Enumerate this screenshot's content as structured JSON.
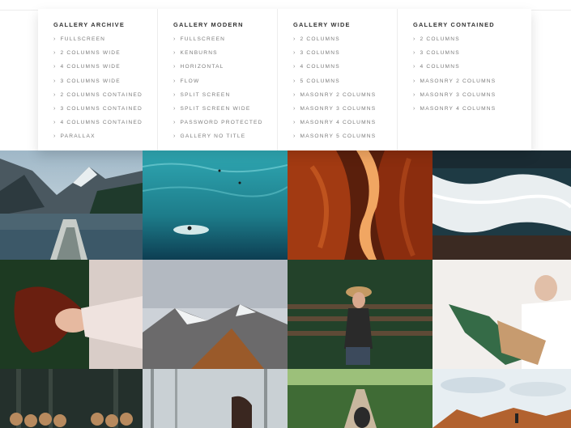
{
  "menu": {
    "columns": [
      {
        "title": "GALLERY ARCHIVE",
        "items": [
          "FULLSCREEN",
          "2 COLUMNS WIDE",
          "4 COLUMNS WIDE",
          "3 COLUMNS WIDE",
          "2 COLUMNS CONTAINED",
          "3 COLUMNS CONTAINED",
          "4 COLUMNS CONTAINED",
          "PARALLAX"
        ]
      },
      {
        "title": "GALLERY MODERN",
        "items": [
          "FULLSCREEN",
          "KENBURNS",
          "HORIZONTAL",
          "FLOW",
          "SPLIT SCREEN",
          "SPLIT SCREEN WIDE",
          "PASSWORD PROTECTED",
          "GALLERY NO TITLE"
        ]
      },
      {
        "title": "GALLERY WIDE",
        "items": [
          "2 COLUMNS",
          "3 COLUMNS",
          "4 COLUMNS",
          "5 COLUMNS",
          "MASONRY 2 COLUMNS",
          "MASONRY 3 COLUMNS",
          "MASONRY 4 COLUMNS",
          "MASONRY 5 COLUMNS"
        ]
      },
      {
        "title": "GALLERY CONTAINED",
        "items": [
          "2 COLUMNS",
          "3 COLUMNS",
          "4 COLUMNS",
          "MASONRY 2 COLUMNS",
          "MASONRY 3 COLUMNS",
          "MASONRY 4 COLUMNS"
        ]
      }
    ],
    "chevron": "›"
  },
  "gallery": {
    "photos": [
      "mountain-lake-boat",
      "turquoise-ocean-surfers",
      "antelope-canyon",
      "ocean-waves-rocks",
      "woman-lying-red-hair",
      "snowy-mountains",
      "woman-straw-hat-bench",
      "woman-holding-bouquet",
      "forest-log-pile",
      "misty-forest-horse",
      "park-path-trees",
      "desert-rocks-sky"
    ]
  },
  "colors": {
    "menu_title": "#333333",
    "menu_item": "#7c7c7c"
  }
}
